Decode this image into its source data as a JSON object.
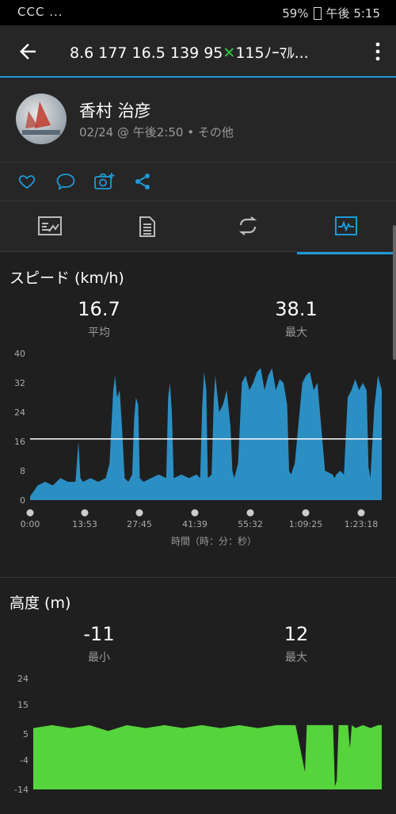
{
  "status_bar": {
    "left": "ССС ...",
    "battery": "59%",
    "time": "午後 5:15"
  },
  "app_bar": {
    "title_part1": "8.6  177  16.5  139  95",
    "title_mark": "✕",
    "title_part2": "115ﾉｰﾏﾙ..."
  },
  "profile": {
    "name": "香村 治彦",
    "meta": "02/24 @ 午後2:50 • その他"
  },
  "speed": {
    "title": "スピード (km/h)",
    "avg_value": "16.7",
    "avg_label": "平均",
    "max_value": "38.1",
    "max_label": "最大",
    "xlabel": "時間（時：分：秒）"
  },
  "altitude": {
    "title": "高度 (m)",
    "min_value": "-11",
    "min_label": "最小",
    "max_value": "12",
    "max_label": "最大"
  },
  "colors": {
    "accent": "#1e9ad6",
    "speed_fill": "#2c8fc4",
    "altitude_fill": "#55d43c"
  },
  "chart_data": [
    {
      "type": "area",
      "title": "スピード (km/h)",
      "xlabel": "時間（時：分：秒）",
      "ylim": [
        0,
        40
      ],
      "yticks": [
        "0",
        "8",
        "16",
        "24",
        "32",
        "40"
      ],
      "xticks": [
        "0:00",
        "13:53",
        "27:45",
        "41:39",
        "55:32",
        "1:09:25",
        "1:23:18"
      ],
      "x_minutes": [
        0,
        2,
        4,
        6,
        8,
        10,
        12,
        12.8,
        13.3,
        14,
        16,
        18,
        20,
        21,
        22,
        22.5,
        23,
        23.7,
        24.3,
        25,
        26,
        27,
        27.5,
        28,
        28.6,
        29,
        30,
        32,
        34,
        36,
        36.5,
        37,
        37.5,
        38,
        40,
        42,
        44,
        45,
        45.5,
        46,
        46.6,
        47,
        48,
        48.6,
        49,
        50,
        51,
        52,
        53,
        53.5,
        54,
        55,
        56,
        57,
        58,
        59,
        60,
        61,
        62,
        63,
        64,
        65,
        66,
        67,
        68,
        68.5,
        69,
        70,
        72,
        73,
        74,
        75,
        76,
        78,
        80,
        80.5,
        81,
        82,
        83,
        84,
        85,
        86,
        87,
        88,
        89,
        89.5,
        90,
        91,
        92,
        93
      ],
      "values": [
        1,
        4,
        5,
        4,
        6,
        5,
        5,
        16,
        6,
        5,
        6,
        5,
        6,
        10,
        30,
        34,
        28,
        30,
        20,
        6,
        5,
        7,
        22,
        28,
        26,
        6,
        5,
        6,
        7,
        6,
        28,
        32,
        24,
        6,
        7,
        6,
        7,
        6,
        25,
        35,
        30,
        6,
        7,
        28,
        34,
        24,
        26,
        30,
        20,
        8,
        6,
        10,
        32,
        34,
        30,
        32,
        35,
        36,
        30,
        34,
        36,
        30,
        33,
        32,
        26,
        8,
        7,
        10,
        32,
        34,
        35,
        30,
        32,
        8,
        7,
        6,
        7,
        8,
        7,
        28,
        30,
        33,
        30,
        32,
        30,
        9,
        6,
        25,
        34,
        30
      ],
      "reference_line": 16.7
    },
    {
      "type": "area",
      "title": "高度 (m)",
      "ylim": [
        -14,
        24
      ],
      "yticks": [
        "-14",
        "-4",
        "5",
        "15",
        "24"
      ],
      "x_minutes": [
        0,
        5,
        10,
        15,
        20,
        25,
        30,
        35,
        40,
        45,
        50,
        55,
        60,
        65,
        70,
        72.5,
        73,
        73.5,
        74,
        78,
        80,
        80.5,
        81,
        81.5,
        82,
        83,
        84,
        84.5,
        85,
        86,
        88,
        90,
        92,
        93
      ],
      "values": [
        7,
        8,
        7,
        8,
        6,
        8,
        7,
        8,
        7,
        8,
        7,
        8,
        7,
        8,
        8,
        -8,
        8,
        8,
        8,
        8,
        8,
        -13,
        -11,
        8,
        8,
        8,
        8,
        0,
        8,
        7,
        8,
        7,
        8,
        8
      ]
    }
  ]
}
